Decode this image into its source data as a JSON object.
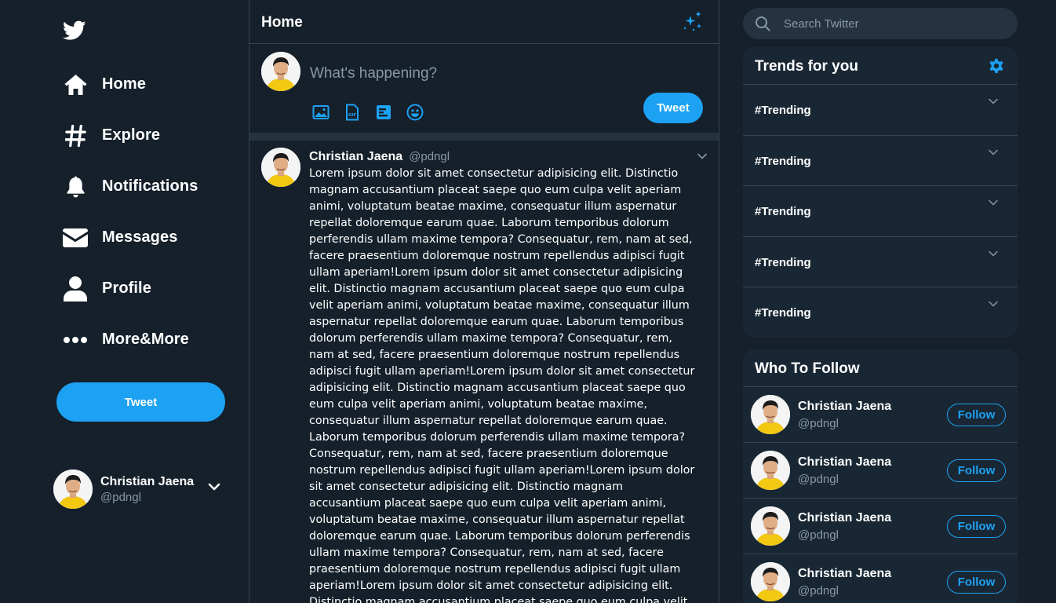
{
  "colors": {
    "background": "#15202b",
    "panel": "#192734",
    "accent": "#1da1f2",
    "muted_text": "#8899a6",
    "border": "#38444d"
  },
  "sidebar": {
    "logo_icon": "twitter-bird-icon",
    "items": [
      {
        "label": "Home",
        "icon": "home-icon"
      },
      {
        "label": "Explore",
        "icon": "hashtag-icon"
      },
      {
        "label": "Notifications",
        "icon": "bell-icon"
      },
      {
        "label": "Messages",
        "icon": "envelope-icon"
      },
      {
        "label": "Profile",
        "icon": "user-icon"
      },
      {
        "label": "More&More",
        "icon": "more-dots-icon"
      }
    ],
    "tweet_label": "Tweet",
    "account": {
      "name": "Christian Jaena",
      "handle": "@pdngl",
      "icon": "chevron-down-icon"
    }
  },
  "main": {
    "title": "Home",
    "header_icon": "sparkle-icon",
    "composer": {
      "placeholder": "What's happening?",
      "tools": [
        "image-icon",
        "gif-icon",
        "poll-icon",
        "emoji-icon"
      ],
      "tweet_label": "Tweet"
    },
    "tweet": {
      "name": "Christian Jaena",
      "handle": "@pdngl",
      "body": "Lorem ipsum dolor sit amet consectetur adipisicing elit. Distinctio magnam accusantium placeat saepe quo eum culpa velit aperiam animi, voluptatum beatae maxime, consequatur illum aspernatur repellat doloremque earum quae. Laborum temporibus dolorum perferendis ullam maxime tempora? Consequatur, rem, nam at sed, facere praesentium doloremque nostrum repellendus adipisci fugit ullam aperiam!Lorem ipsum dolor sit amet consectetur adipisicing elit. Distinctio magnam accusantium placeat saepe quo eum culpa velit aperiam animi, voluptatum beatae maxime, consequatur illum aspernatur repellat doloremque earum quae. Laborum temporibus dolorum perferendis ullam maxime tempora? Consequatur, rem, nam at sed, facere praesentium doloremque nostrum repellendus adipisci fugit ullam aperiam!Lorem ipsum dolor sit amet consectetur adipisicing elit. Distinctio magnam accusantium placeat saepe quo eum culpa velit aperiam animi, voluptatum beatae maxime, consequatur illum aspernatur repellat doloremque earum quae. Laborum temporibus dolorum perferendis ullam maxime tempora? Consequatur, rem, nam at sed, facere praesentium doloremque nostrum repellendus adipisci fugit ullam aperiam!Lorem ipsum dolor sit amet consectetur adipisicing elit. Distinctio magnam accusantium placeat saepe quo eum culpa velit aperiam animi, voluptatum beatae maxime, consequatur illum aspernatur repellat doloremque earum quae. Laborum temporibus dolorum perferendis ullam maxime tempora? Consequatur, rem, nam at sed, facere praesentium doloremque nostrum repellendus adipisci fugit ullam aperiam!Lorem ipsum dolor sit amet consectetur adipisicing elit. Distinctio magnam accusantium placeat saepe quo eum culpa velit aperiam animi"
    }
  },
  "right": {
    "search": {
      "placeholder": "Search Twitter",
      "value": ""
    },
    "trends": {
      "title": "Trends for you",
      "items": [
        "#Trending",
        "#Trending",
        "#Trending",
        "#Trending",
        "#Trending"
      ]
    },
    "who_to_follow": {
      "title": "Who To Follow",
      "items": [
        {
          "name": "Christian Jaena",
          "handle": "@pdngl",
          "button": "Follow"
        },
        {
          "name": "Christian Jaena",
          "handle": "@pdngl",
          "button": "Follow"
        },
        {
          "name": "Christian Jaena",
          "handle": "@pdngl",
          "button": "Follow"
        },
        {
          "name": "Christian Jaena",
          "handle": "@pdngl",
          "button": "Follow"
        }
      ]
    }
  }
}
